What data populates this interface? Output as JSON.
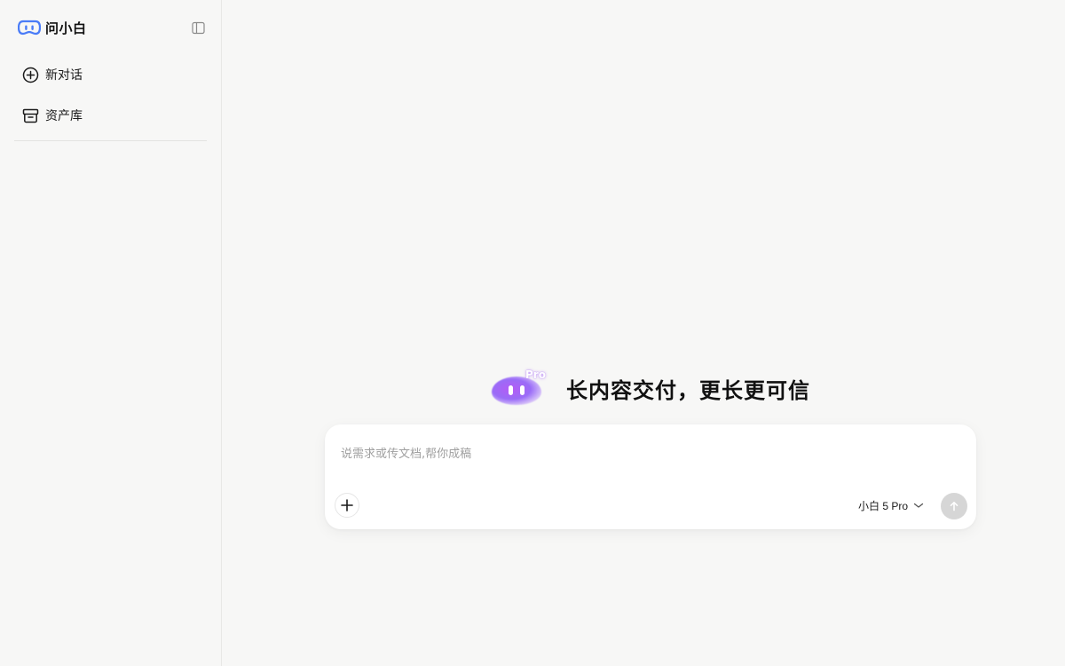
{
  "brand": {
    "name": "问小白",
    "logo_icon": "ai-logo-icon",
    "logo_color": "#4a7cf7"
  },
  "sidebar": {
    "collapse_icon": "sidebar-toggle-icon",
    "items": [
      {
        "label": "新对话",
        "icon": "plus-circle-icon"
      },
      {
        "label": "资产库",
        "icon": "archive-box-icon"
      }
    ]
  },
  "hero": {
    "badge": "Pro",
    "tagline": "长内容交付，更长更可信",
    "mascot_color": "#a364f6"
  },
  "composer": {
    "placeholder": "说需求或传文档,帮你成稿",
    "value": "",
    "attach_icon": "plus-icon",
    "model": "小白 5 Pro",
    "model_icon": "chevron-down-icon",
    "send_icon": "arrow-up-icon",
    "send_color": "#d6d6d6"
  }
}
